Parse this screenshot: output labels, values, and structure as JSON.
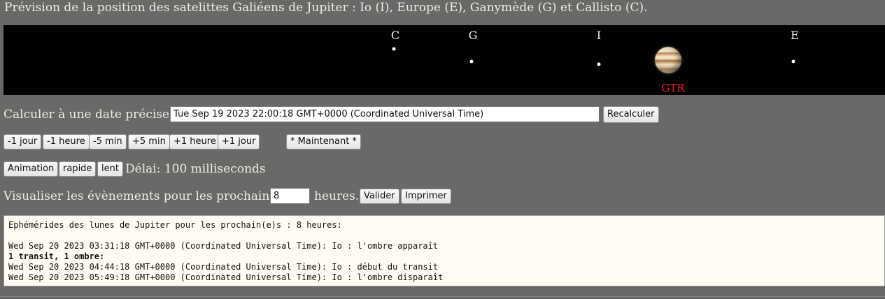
{
  "page": {
    "title": "Prévision de la position des satelittes Galiéens de Jupiter : Io (I), Europe (E), Ganymède (G) et Callisto (C)."
  },
  "sky": {
    "moons": [
      {
        "label": "C",
        "name": "Callisto"
      },
      {
        "label": "G",
        "name": "Ganymède"
      },
      {
        "label": "I",
        "name": "Io"
      },
      {
        "label": "E",
        "name": "Europe"
      }
    ],
    "jupiter_event_code": "GTR",
    "event_color": "#ff1a1a"
  },
  "date_row": {
    "label": "Calculer à une date précise :",
    "date_value": "Tue Sep 19 2023 22:00:18 GMT+0000 (Coordinated Universal Time)",
    "recalc_button": "Recalculer"
  },
  "step_buttons": {
    "minus_day": "-1 jour",
    "minus_hour": "-1 heure",
    "minus_5min": "-5 min",
    "plus_5min": "+5 min",
    "plus_hour": "+1 heure",
    "plus_day": "+1 jour",
    "now": "* Maintenant *"
  },
  "animation": {
    "button": "Animation",
    "fast": "rapide",
    "slow": "lent",
    "delay_text": "Délai: 100 milliseconds"
  },
  "events_row": {
    "label_before": "Visualiser les évènements pour les prochaines",
    "hours_value": "8",
    "label_after": "heures.",
    "validate_button": "Valider",
    "print_button": "Imprimer"
  },
  "log": {
    "header": "Ephémérides des lunes de Jupiter pour les prochain(e)s : 8 heures:",
    "lines": [
      "Wed Sep 20 2023 03:31:18 GMT+0000 (Coordinated Universal Time): Io : l'ombre apparaît",
      "1 transit, 1 ombre:",
      "Wed Sep 20 2023 04:44:18 GMT+0000 (Coordinated Universal Time): Io : début du transit",
      "Wed Sep 20 2023 05:49:18 GMT+0000 (Coordinated Universal Time): Io : l'ombre disparaît"
    ]
  },
  "colors": {
    "background": "#6b6967",
    "sky": "#000000",
    "log_background": "#fffdf3"
  }
}
